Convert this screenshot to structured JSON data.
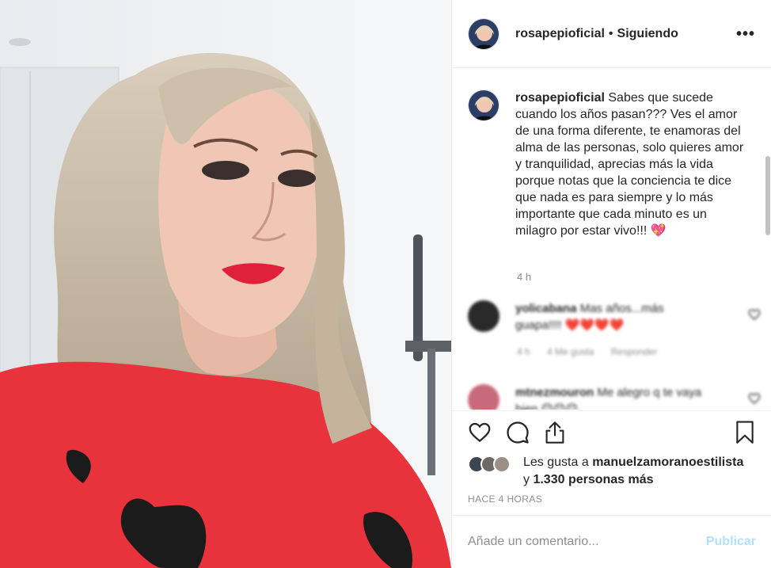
{
  "post": {
    "username": "rosapepioficial",
    "separator": "•",
    "follow_status": "Siguiendo",
    "more_icon": "•••",
    "caption_text": "Sabes que sucede cuando los años pasan??? Ves el amor de una forma diferente, te enamoras del alma de las personas, solo quieres amor y tranquilidad, aprecias más la vida porque notas que la conciencia te dice que nada es para siempre y lo más importante que cada minuto es un milagro por estar vivo!!!",
    "caption_emoji": "💖",
    "time": "4 h"
  },
  "comments": [
    {
      "username": "yolicabana",
      "text": "Mas años...más guapa!!!! ❤️❤️❤️❤️",
      "time": "4 h",
      "likes": "4 Me gusta",
      "reply": "Responder"
    },
    {
      "username": "mtnezmouron",
      "text": "Me alegro q te vaya bien 😊😊😊"
    }
  ],
  "actions": {
    "like_icon": "heart-outline-icon",
    "comment_icon": "comment-icon",
    "share_icon": "share-icon",
    "save_icon": "bookmark-icon"
  },
  "likes": {
    "prefix": "Les gusta a",
    "user": "manuelzamoranoestilista",
    "conjunction": "y",
    "count": "1.330 personas más"
  },
  "timestamp": "HACE 4 HORAS",
  "comment_box": {
    "placeholder": "Añade un comentario...",
    "publish": "Publicar"
  },
  "colors": {
    "accent_disabled": "#b2dffc",
    "muted": "#8e8e8e",
    "text": "#262626",
    "sweater": "#e8323c"
  }
}
